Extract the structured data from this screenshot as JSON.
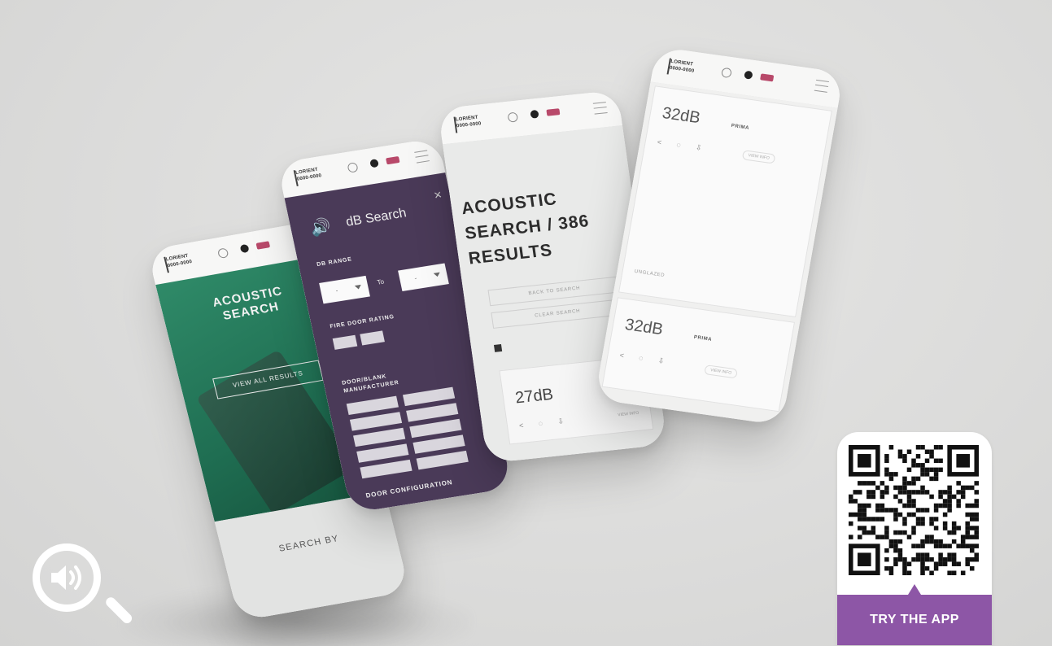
{
  "phone1": {
    "logo": [
      "LORIENT",
      "0000-0000"
    ],
    "hero_title": "ACOUSTIC\nSEARCH",
    "hero_text": "",
    "hero_button": "VIEW ALL RESULTS",
    "search_by": "SEARCH BY"
  },
  "phone2": {
    "title": "dB Search",
    "close": "×",
    "db_range_label": "DB RANGE",
    "to_label": "To",
    "fire_rating_label": "FIRE DOOR RATING",
    "fire_options": [
      "",
      ""
    ],
    "manufacturer_label": "DOOR/BLANK MANUFACTURER",
    "manufacturers": [
      "",
      "",
      "",
      "",
      "",
      "",
      "",
      "",
      "",
      ""
    ],
    "door_config_label": "DOOR CONFIGURATION"
  },
  "phone3": {
    "title_line1": "ACOUSTIC",
    "title_line2": "SEARCH / 386",
    "title_line3": "RESULTS",
    "back_button": "BACK TO SEARCH",
    "clear_button": "CLEAR SEARCH",
    "sort_label": "",
    "card_value": "27dB",
    "card_view": "VIEW INFO"
  },
  "phone4": {
    "card1_value": "32dB",
    "card1_product": "PRIMA",
    "card1_lines": [
      "",
      "",
      "",
      "UNGLAZED"
    ],
    "card2_value": "32dB",
    "card2_product": "PRIMA",
    "view_info": "VIEW INFO"
  },
  "qr": {
    "cta": "TRY THE APP"
  },
  "colors": {
    "green": "#1f6e52",
    "purple_panel": "#4a3a58",
    "accent_purple": "#8d56a6",
    "background": "#dcdcdb"
  },
  "icons": {
    "badge": "acoustic-search-icon",
    "qr": "qr-code-icon"
  }
}
